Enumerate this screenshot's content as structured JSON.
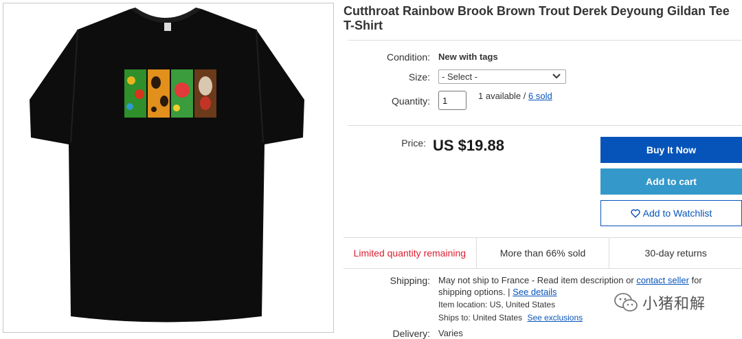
{
  "product": {
    "title": "Cutthroat Rainbow Brook Brown Trout Derek Deyoung Gildan Tee T-Shirt",
    "image_alt": "Black T-shirt with four fish skin print panels"
  },
  "details": {
    "condition_label": "Condition:",
    "condition_value": "New with tags",
    "size_label": "Size:",
    "size_selected": "- Select -",
    "quantity_label": "Quantity:",
    "quantity_value": "1",
    "available_text": "1 available /",
    "sold_link": "6 sold"
  },
  "price": {
    "label": "Price:",
    "value": "US $19.88"
  },
  "buttons": {
    "buy_now": "Buy It Now",
    "add_to_cart": "Add to cart",
    "add_to_watchlist": "Add to Watchlist"
  },
  "highlights": {
    "limited": "Limited quantity remaining",
    "sold_pct": "More than 66% sold",
    "returns": "30-day returns"
  },
  "shipping": {
    "label": "Shipping:",
    "line1_prefix": "May not ship to France - Read item description or",
    "contact_link": "contact seller",
    "line1_suffix": "for",
    "line2": "shipping options. |",
    "see_details": "See details",
    "location_label": "Item location:",
    "location_value": "US, United States",
    "ships_to_label": "Ships to:",
    "ships_to_value": "United States",
    "see_exclusions": "See exclusions",
    "delivery_label": "Delivery:",
    "delivery_value": "Varies"
  },
  "watermark": {
    "text": "小猪和解",
    "icon": "wechat-icon"
  },
  "colors": {
    "primary_blue": "#0654ba",
    "cart_blue": "#3498ca",
    "alert_red": "#dd1e31"
  }
}
